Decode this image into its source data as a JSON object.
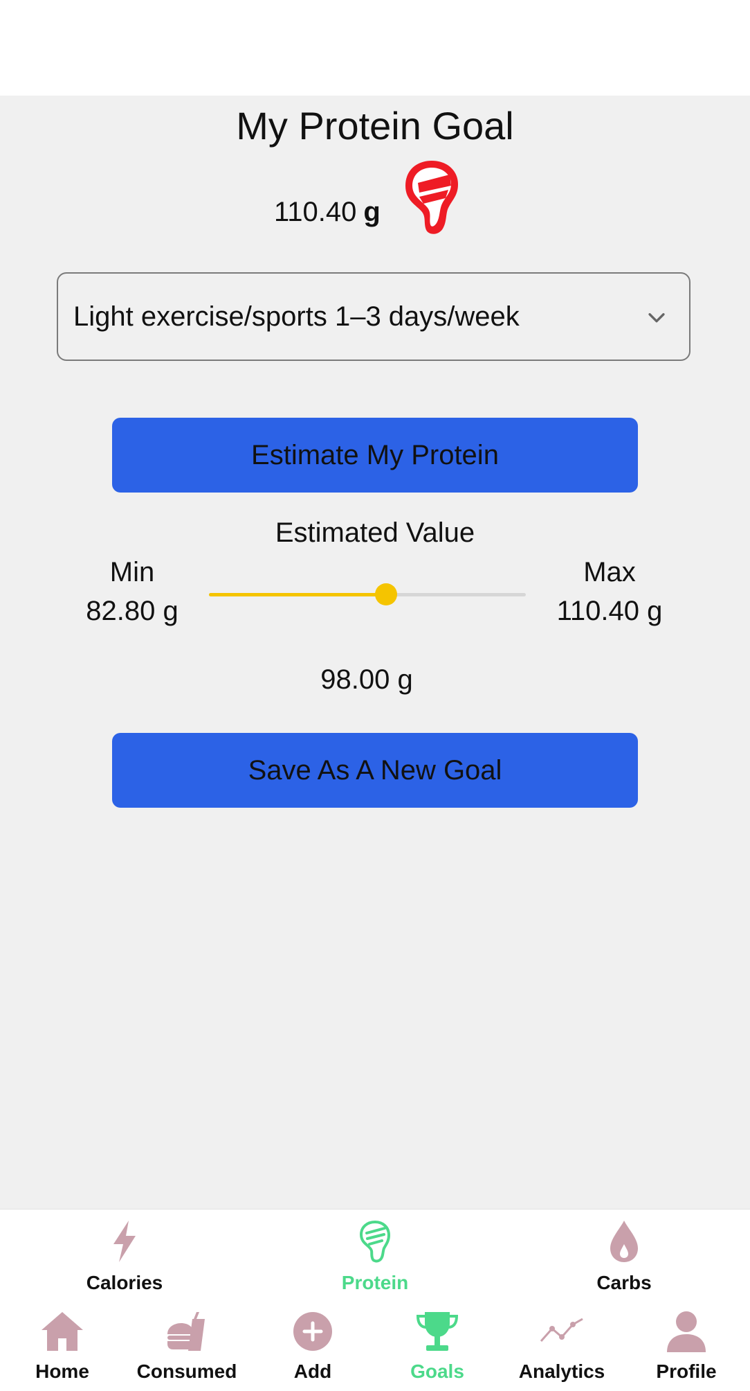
{
  "page": {
    "title": "My Protein Goal"
  },
  "current_goal": {
    "value": "110.40",
    "unit": "g"
  },
  "activity_select": {
    "selected": "Light exercise/sports 1–3 days/week"
  },
  "buttons": {
    "estimate": "Estimate My Protein",
    "save": "Save As A New Goal"
  },
  "estimate": {
    "label": "Estimated Value",
    "min_label": "Min",
    "min_value": "82.80 g",
    "max_label": "Max",
    "max_value": "110.40 g",
    "slider_fraction": 0.56,
    "selected_value": "98.00 g"
  },
  "subnav": {
    "active": "protein",
    "items": [
      {
        "label": "Calories",
        "icon": "lightning-icon"
      },
      {
        "label": "Protein",
        "icon": "meat-icon"
      },
      {
        "label": "Carbs",
        "icon": "drop-icon"
      }
    ]
  },
  "bottomnav": {
    "active": "goals",
    "items": [
      {
        "label": "Home",
        "icon": "home-icon"
      },
      {
        "label": "Consumed",
        "icon": "food-icon"
      },
      {
        "label": "Add",
        "icon": "plus-circle-icon"
      },
      {
        "label": "Goals",
        "icon": "trophy-icon"
      },
      {
        "label": "Analytics",
        "icon": "line-chart-icon"
      },
      {
        "label": "Profile",
        "icon": "person-icon"
      }
    ]
  },
  "colors": {
    "primary_button": "#2c62e6",
    "slider": "#f5c400",
    "active_tab": "#4cd98a",
    "inactive_icon": "#c9a0ab",
    "meat_red": "#ee1c25"
  }
}
